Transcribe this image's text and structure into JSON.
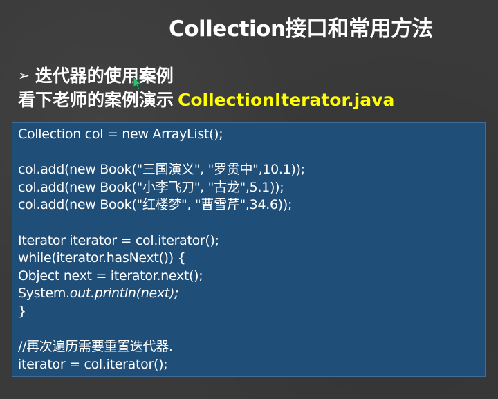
{
  "slide": {
    "title": "Collection接口和常用方法",
    "bullet_icon": "arrow-right-icon",
    "bullet_arrow": "➢",
    "subtitle": "迭代器的使用案例",
    "demo_prefix": "看下老师的案例演示",
    "demo_file": "CollectionIterator.java"
  },
  "colors": {
    "background": "#3a3a3a",
    "code_background": "#1f4e79",
    "highlight": "#ffff00",
    "text": "#ffffff"
  },
  "code": {
    "line1": "Collection col = new ArrayList();",
    "line2": "",
    "line3": "col.add(new Book(\"三国演义\", \"罗贯中\",10.1));",
    "line4": "col.add(new Book(\"小李飞刀\", \"古龙\",5.1));",
    "line5": "col.add(new Book(\"红楼梦\", \"曹雪芹\",34.6));",
    "line6": "",
    "line7": "Iterator iterator = col.iterator();",
    "line8": "while(iterator.hasNext()) {",
    "line9": "Object next = iterator.next();",
    "line10_prefix": "System.",
    "line10_italic": "out.println(next);",
    "line11": "}",
    "line12": "",
    "line13": "//再次遍历需要重置迭代器.",
    "line14": "iterator = col.iterator();"
  }
}
